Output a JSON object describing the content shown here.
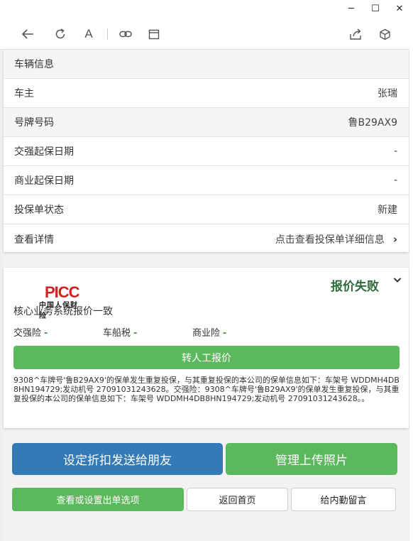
{
  "window": {
    "controls": [
      "─",
      "☐",
      "✕"
    ]
  },
  "toolbar": {
    "icons": [
      "back-arrow-icon",
      "refresh-icon",
      "font-size-icon",
      "link-icon",
      "window-icon",
      "share-icon",
      "cube-icon"
    ],
    "font_icon_glyph": "A"
  },
  "vehicle": {
    "title": "车辆信息",
    "rows": [
      {
        "label": "车主",
        "value": "张瑞"
      },
      {
        "label": "号牌号码",
        "value": "鲁B29AX9"
      },
      {
        "label": "交强起保日期",
        "value": "-"
      },
      {
        "label": "商业起保日期",
        "value": "-"
      },
      {
        "label": "投保单状态",
        "value": "新建"
      },
      {
        "label": "查看详情",
        "value": "点击查看投保单详细信息"
      }
    ]
  },
  "quote": {
    "logo_text": "PICC",
    "logo_sub": "中国人保财险",
    "status": "报价失败",
    "consistency": "核心业务系统报价一致",
    "insurance": [
      {
        "label": "交强险",
        "value": "-"
      },
      {
        "label": "车船税",
        "value": "-"
      },
      {
        "label": "商业险",
        "value": "-"
      }
    ],
    "manual_button": "转人工报价",
    "notice": "9308^车牌号'鲁B29AX9'的保单发生重复投保，与其重复投保的本公司的保单信息如下：车架号 WDDMH4DB8HN194729;发动机号 27091031243628。交强险：9308^车牌号'鲁B29AX9'的保单发生重复投保，与其重复投保的本公司的保单信息如下：车架号 WDDMH4DB8HN194729;发动机号 27091031243628。。"
  },
  "actions": {
    "discount_button": "设定折扣发送给朋友",
    "photos_button": "管理上传照片",
    "options_button": "查看或设置出单选项",
    "home_button": "返回首页",
    "message_button": "给内勤留言"
  },
  "colors": {
    "primary_blue": "#337ab7",
    "success_green": "#5cb85c",
    "picc_red": "#d21f1f",
    "status_green": "#2e6b3a"
  }
}
